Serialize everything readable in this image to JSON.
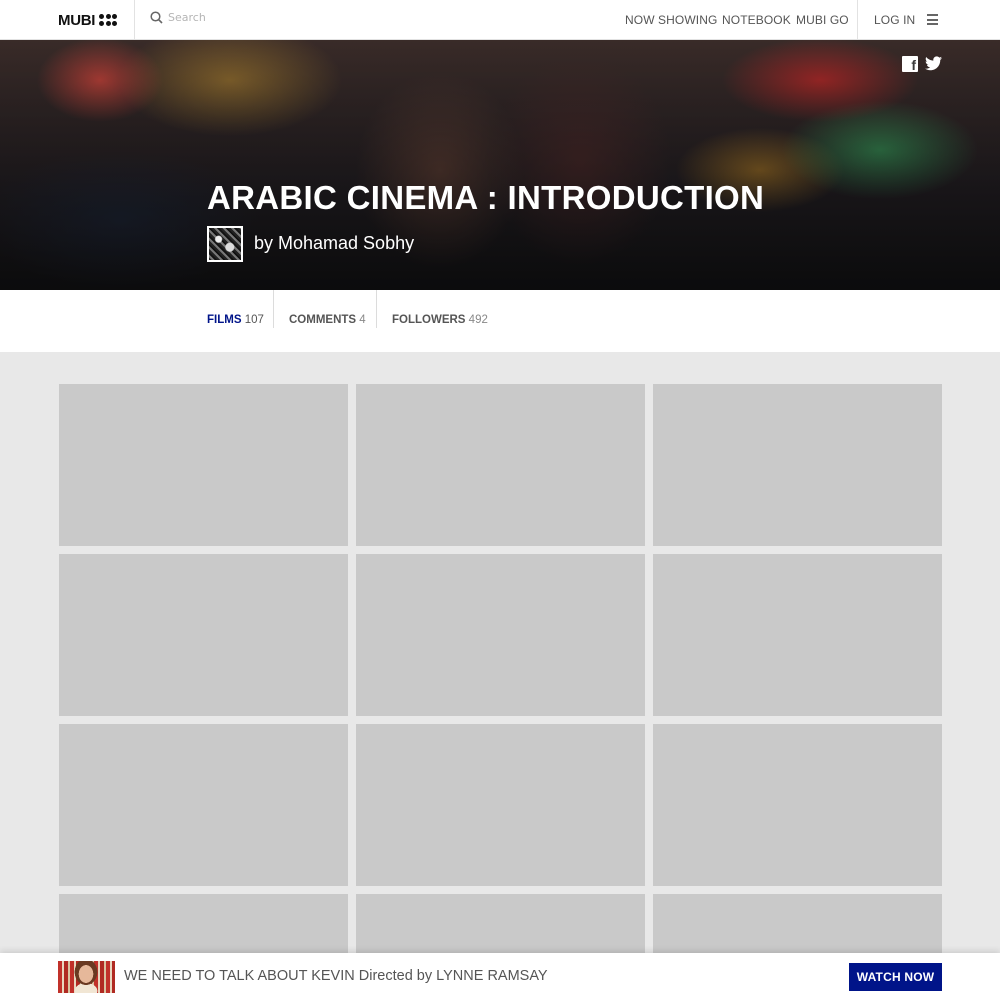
{
  "header": {
    "logo_text": "MUBI",
    "search_placeholder": "Search",
    "nav": [
      "NOW SHOWING",
      "NOTEBOOK",
      "MUBI GO"
    ],
    "login": "LOG IN",
    "menu_icon": "hamburger-icon"
  },
  "hero": {
    "title": "ARABIC CINEMA : INTRODUCTION",
    "byline": "by Mohamad Sobhy",
    "share_icons": [
      "facebook-icon",
      "twitter-icon"
    ]
  },
  "tabs": [
    {
      "label": "FILMS",
      "count": "107",
      "active": true
    },
    {
      "label": "COMMENTS",
      "count": "4",
      "active": false
    },
    {
      "label": "FOLLOWERS",
      "count": "492",
      "active": false
    }
  ],
  "promo": {
    "film_title": "WE NEED TO TALK ABOUT KEVIN",
    "directed_by": "Directed by",
    "director": "LYNNE RAMSAY",
    "button": "WATCH NOW"
  },
  "colors": {
    "accent": "#001489",
    "placeholder_card": "#c9c9c9",
    "page_background": "#e8e8e8"
  }
}
